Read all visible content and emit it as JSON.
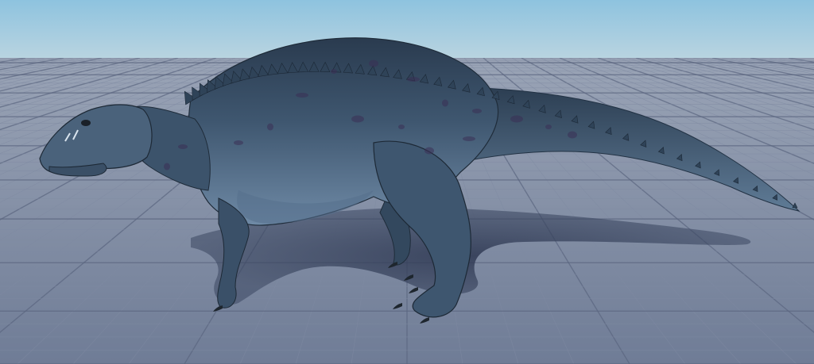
{
  "scene": {
    "subject": "dinosaur-model",
    "environment": "grid-floor",
    "colors": {
      "sky_top": "#8ec3df",
      "sky_horizon": "#b9d4e0",
      "floor_near": "#6f7c96",
      "floor_far": "#9aa4b6",
      "grid_line": "#5b6680",
      "grid_minor": "#7f8aa2",
      "body_dark": "#2a3b4f",
      "body_mid": "#3f5770",
      "body_light": "#6f8aa6",
      "belly": "#55708c",
      "spikes": "#2f4358",
      "shadow": "#3a4660",
      "claw": "#1e262e",
      "spot": "#3a2f55"
    }
  }
}
